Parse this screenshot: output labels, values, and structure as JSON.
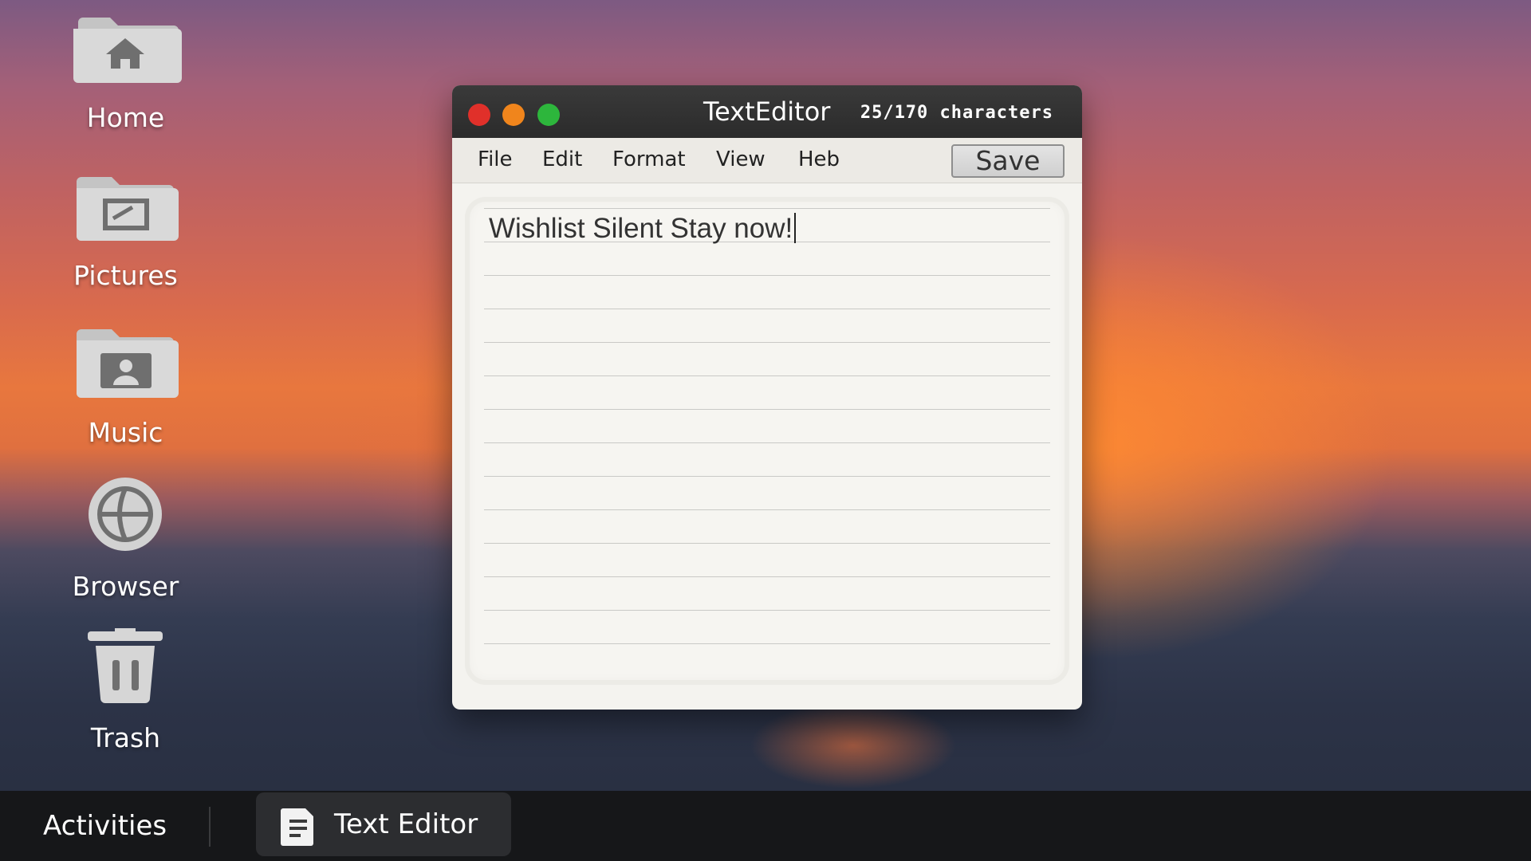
{
  "desktop": {
    "icons": [
      {
        "label": "Home",
        "icon": "home-folder-icon"
      },
      {
        "label": "Pictures",
        "icon": "pictures-folder-icon"
      },
      {
        "label": "Music",
        "icon": "music-folder-icon"
      },
      {
        "label": "Browser",
        "icon": "globe-icon"
      },
      {
        "label": "Trash",
        "icon": "trash-icon"
      }
    ]
  },
  "window": {
    "title": "TextEditor",
    "char_count": "25/170 characters",
    "menu": [
      "File",
      "Edit",
      "Format",
      "View",
      "Heb"
    ],
    "save_label": "Save",
    "content": "Wishlist Silent Stay now!"
  },
  "taskbar": {
    "activities_label": "Activities",
    "app_label": "Text Editor",
    "app_icon": "document-icon"
  },
  "colors": {
    "close": "#e0302a",
    "minimize": "#f0851c",
    "maximize": "#2db63c"
  }
}
